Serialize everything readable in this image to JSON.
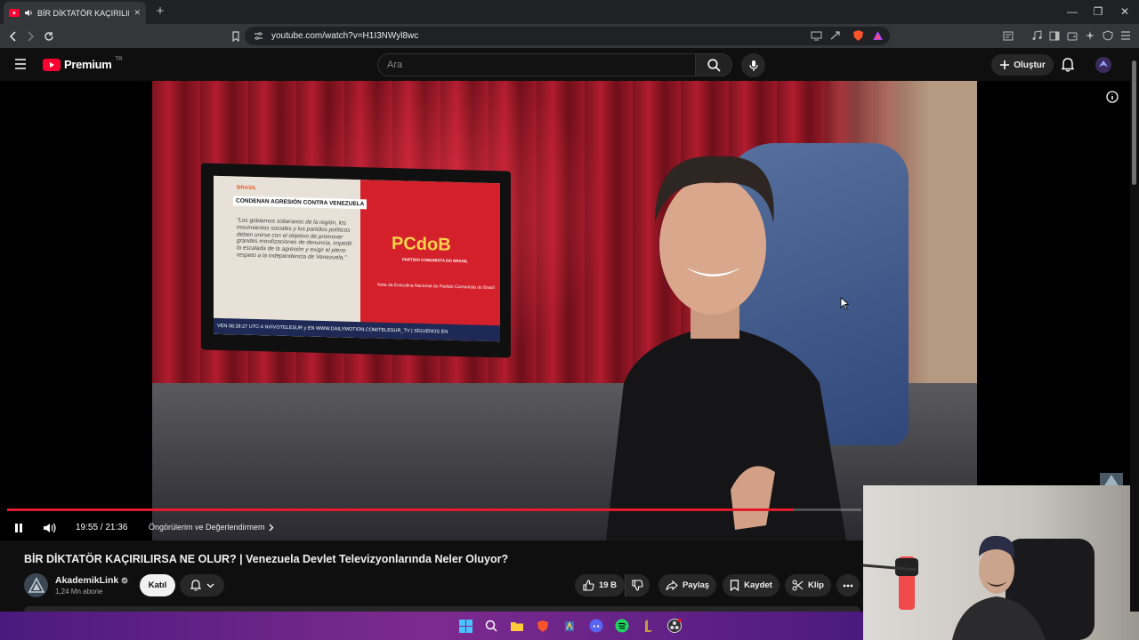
{
  "browser": {
    "tab_title": "BİR DİKTATÖR KAÇIRILIRSA N",
    "url": "youtube.com/watch?v=H1I3NWyl8wc",
    "new_tab": "+",
    "close": "✕"
  },
  "header": {
    "logo_word": "Premium",
    "country_code": "TR",
    "search_placeholder": "Ara",
    "create_label": "Oluştur"
  },
  "video_frame": {
    "tv_tag": "BRASIL",
    "tv_headline": "CONDENAN AGRESIÓN CONTRA VENEZUELA",
    "tv_quote": "\"Los gobiernos soberanos de la región, los movimientos sociales y los partidos políticos deben unirse con el objetivo de promover grandes movilizaciones de denuncia, impedir la escalada de la agresión y exigir el pleno respeto a la independencia de Venezuela.\"",
    "tv_party_logo": "PCdoB",
    "tv_party_sub": "PARTIDO COMUNISTA DO BRASIL",
    "tv_note": "Nota da Executiva Nacional do Partido Comunista do Brasil",
    "tv_ticker": "VEN 08:28:27 UTC-4   NVIVOTELESUR y EN WWW.DAILYMOTION.COM/TELESUR_TV | SÍGUENOS EN"
  },
  "player": {
    "time": "19:55 / 21:36",
    "progress_fraction": 0.921,
    "chapter": "Öngörülerim ve Değerlendirmem",
    "accent": "#e21b2c"
  },
  "video": {
    "title": "BİR DİKTATÖR KAÇIRILIRSA NE OLUR? | Venezuela Devlet Televizyonlarında Neler Oluyor?",
    "channel": "AkademikLink",
    "subscribers": "1,24 Mn abone",
    "join_label": "Katıl",
    "likes": "19 B",
    "share_label": "Paylaş",
    "save_label": "Kaydet",
    "clip_label": "Klip"
  }
}
